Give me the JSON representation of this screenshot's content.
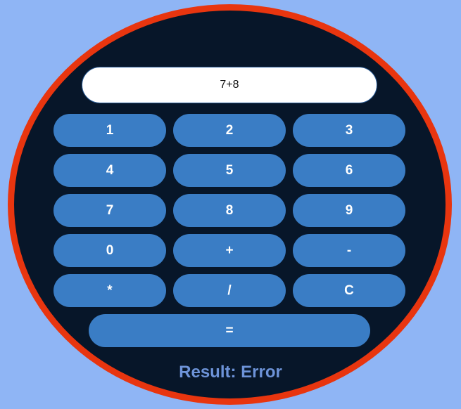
{
  "display": {
    "value": "7+8"
  },
  "keypad": {
    "keys": [
      "1",
      "2",
      "3",
      "4",
      "5",
      "6",
      "7",
      "8",
      "9",
      "0",
      "+",
      "-",
      "*",
      "/",
      "C"
    ],
    "equals_label": "="
  },
  "result": {
    "text": "Result: Error"
  },
  "colors": {
    "background": "#8fb5f5",
    "body": "#071629",
    "border": "#e8350f",
    "key": "#3a7dc5",
    "result_text": "#6d93d8"
  }
}
